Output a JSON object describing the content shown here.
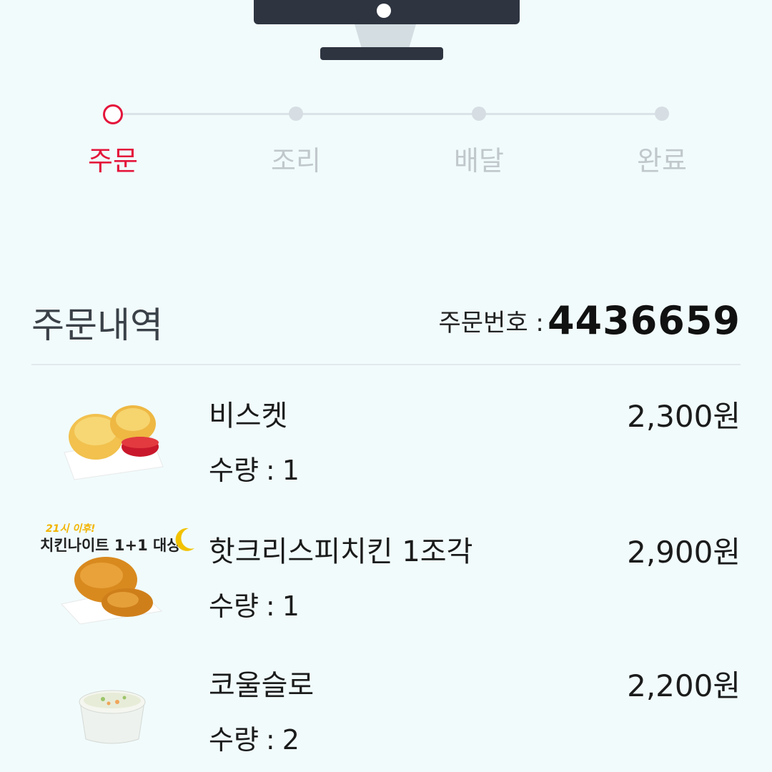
{
  "progress": {
    "steps": [
      {
        "label": "주문",
        "state": "active"
      },
      {
        "label": "조리",
        "state": "inactive"
      },
      {
        "label": "배달",
        "state": "inactive"
      },
      {
        "label": "완료",
        "state": "inactive"
      }
    ],
    "active_color": "#e4153b",
    "inactive_color": "#c1c8cc"
  },
  "order": {
    "title": "주문내역",
    "number_label": "주문번호 :",
    "number_value": "4436659"
  },
  "items": [
    {
      "name": "비스켓",
      "qty_label": "수량",
      "qty_value": "1",
      "price": "2,300원",
      "image_icon": "biscuit-image"
    },
    {
      "name": "핫크리스피치킨 1조각",
      "qty_label": "수량",
      "qty_value": "1",
      "price": "2,900원",
      "image_icon": "fried-chicken-image",
      "promo": {
        "line1": "21시 이후!",
        "line2": "치킨나이트 1+1 대상"
      }
    },
    {
      "name": "코울슬로",
      "qty_label": "수량",
      "qty_value": "2",
      "price": "2,200원",
      "image_icon": "coleslaw-image"
    }
  ],
  "colors": {
    "background": "#f1fbfc",
    "accent": "#e4153b",
    "monitor": "#2e3440"
  }
}
